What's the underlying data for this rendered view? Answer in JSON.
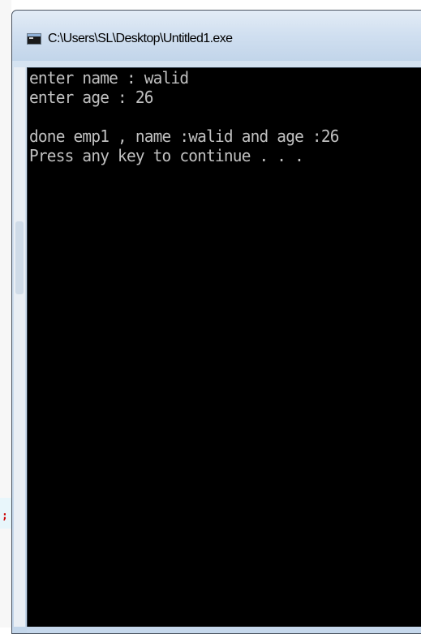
{
  "window": {
    "title": "C:\\Users\\SL\\Desktop\\Untitled1.exe",
    "icon": "console-window-icon"
  },
  "console": {
    "lines": [
      "enter name : walid",
      "enter age : 26",
      "",
      "done emp1 , name :walid and age :26",
      "Press any key to continue . . ."
    ]
  },
  "background": {
    "fragment_text": ";"
  },
  "colors": {
    "console_bg": "#000000",
    "console_text": "#c0c0c0",
    "titlebar": "#d0dff0",
    "fragment_text": "#cc0000"
  }
}
